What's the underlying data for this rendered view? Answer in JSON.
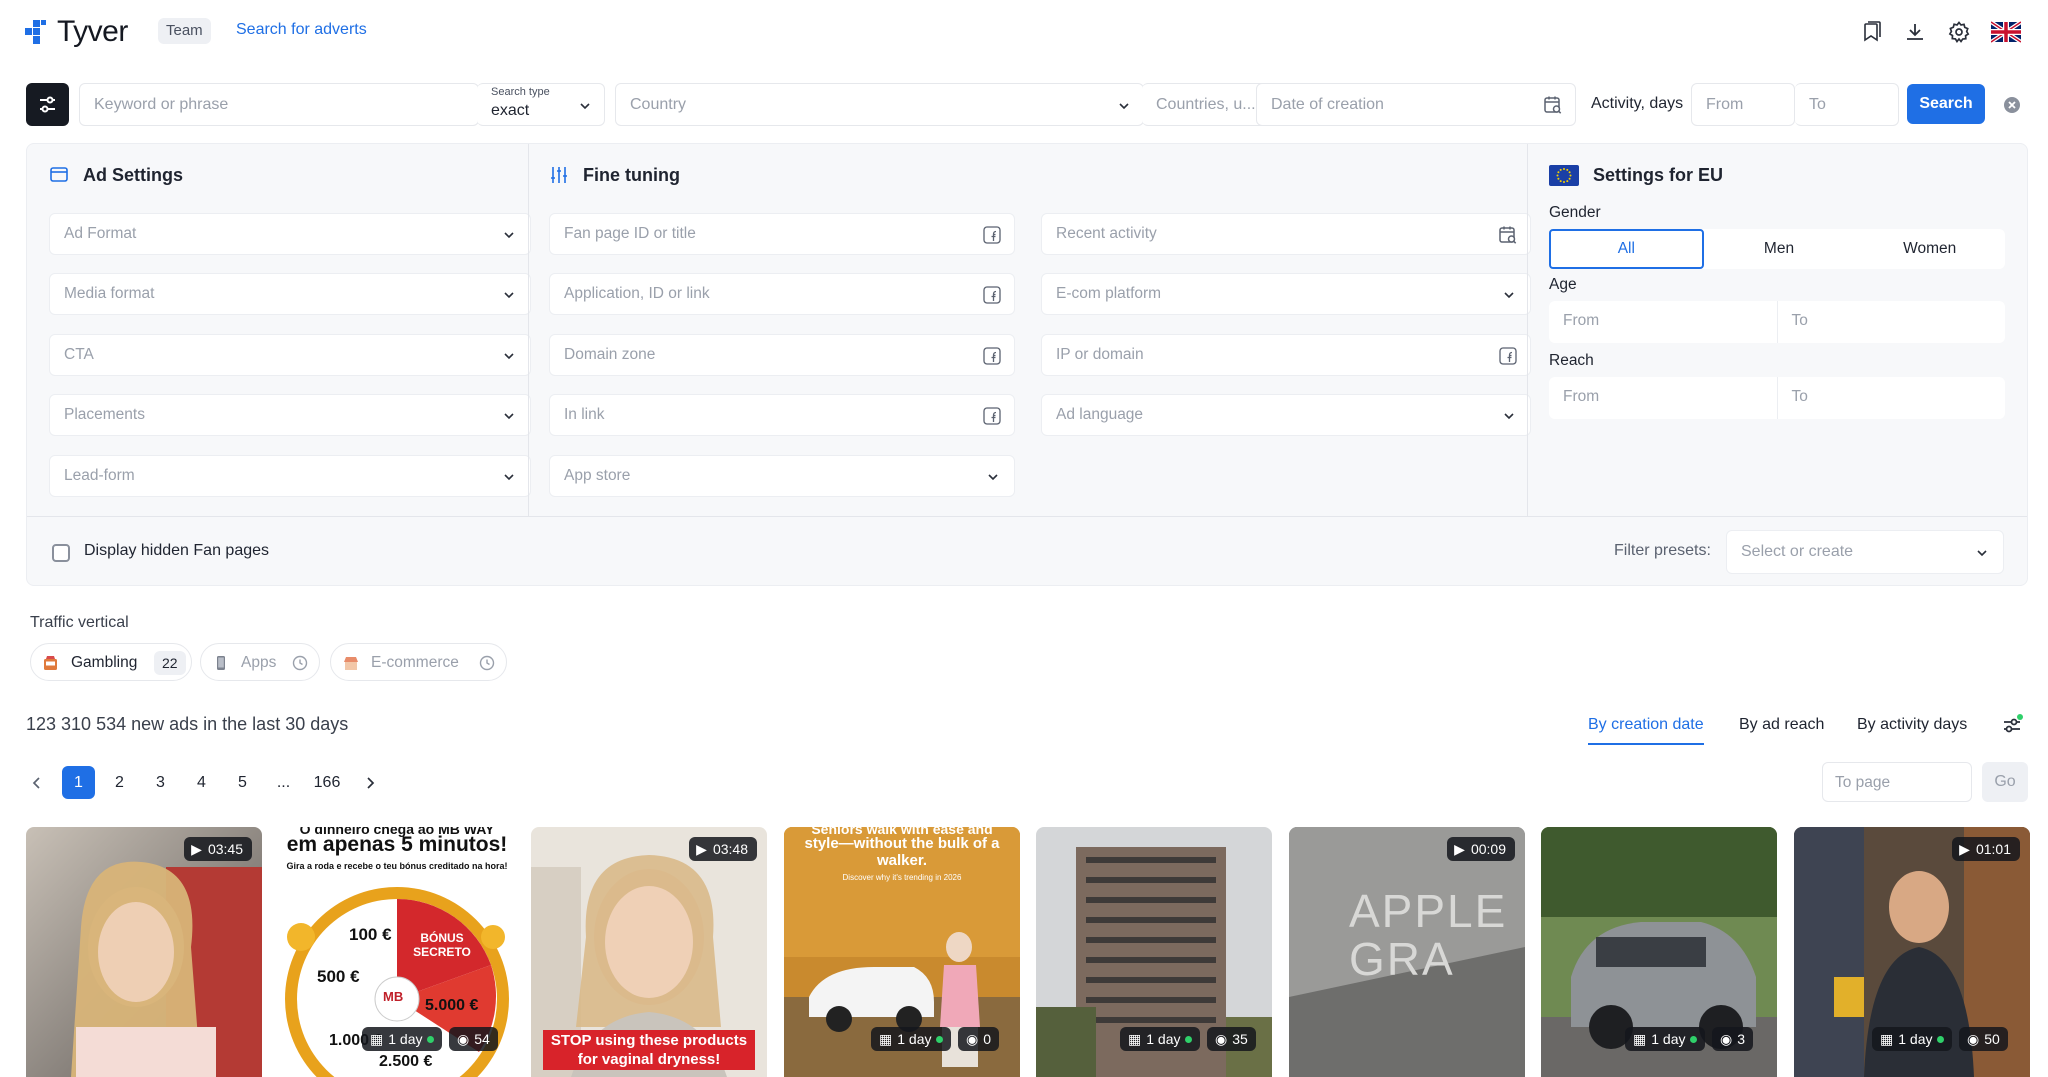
{
  "header": {
    "brand": "Tyver",
    "team_badge": "Team",
    "search_link": "Search for adverts"
  },
  "search": {
    "keyword_placeholder": "Keyword or phrase",
    "search_type_label": "Search type",
    "search_type_value": "exact",
    "country_placeholder": "Country",
    "countries_placeholder": "Countries, u...",
    "date_placeholder": "Date of creation",
    "activity_label": "Activity, days",
    "from_placeholder": "From",
    "to_placeholder": "To",
    "search_button": "Search"
  },
  "ad_settings": {
    "title": "Ad Settings",
    "fields": [
      "Ad Format",
      "Media format",
      "CTA",
      "Placements",
      "Lead-form"
    ]
  },
  "fine_tuning": {
    "title": "Fine tuning",
    "left_fields": [
      "Fan page ID or title",
      "Application, ID or link",
      "Domain zone",
      "In link",
      "App store"
    ],
    "right_fields": [
      "Recent activity",
      "E-com platform",
      "IP or domain",
      "Ad language"
    ]
  },
  "eu_settings": {
    "title": "Settings for EU",
    "gender_label": "Gender",
    "gender_options": [
      "All",
      "Men",
      "Women"
    ],
    "gender_selected": "All",
    "age_label": "Age",
    "reach_label": "Reach",
    "from": "From",
    "to": "To"
  },
  "panel_footer": {
    "hidden_fan_pages": "Display hidden Fan pages",
    "filter_presets_label": "Filter presets:",
    "filter_presets_placeholder": "Select or create"
  },
  "traffic_vertical": {
    "label": "Traffic vertical",
    "chips": [
      {
        "label": "Gambling",
        "count": "22",
        "icon": "slot-machine-icon"
      },
      {
        "label": "Apps",
        "icon": "phone-icon"
      },
      {
        "label": "E-commerce",
        "icon": "shop-icon"
      }
    ]
  },
  "results": {
    "stats": "123 310 534 new ads in the last 30 days",
    "sort_options": [
      "By creation date",
      "By ad reach",
      "By activity days"
    ],
    "sort_active": "By creation date"
  },
  "pagination": {
    "pages": [
      "1",
      "2",
      "3",
      "4",
      "5",
      "...",
      "166"
    ],
    "current": "1",
    "to_page_placeholder": "To page",
    "go_button": "Go"
  },
  "cards": [
    {
      "duration": "03:45",
      "days": "",
      "views": ""
    },
    {
      "duration": "",
      "days": "1 day",
      "views": "54",
      "headline": "em apenas 5 minutos!",
      "subline": "Gira a roda e recebe o teu bónus creditado na hora!",
      "wheel_values": [
        "100 €",
        "BÓNUS SECRETO",
        "500 €",
        "5.000 €",
        "1.000 €",
        "2.500 €"
      ],
      "wheel_center": "MB",
      "top_text": "O dinheiro chega ao MB WAY"
    },
    {
      "duration": "03:48",
      "days": "",
      "views": "",
      "caption": "STOP using these products for vaginal dryness!"
    },
    {
      "duration": "",
      "days": "1 day",
      "views": "0",
      "headline": "style—without the bulk of a walker.",
      "subline": "Discover why it's trending in 2026",
      "top_text": "Seniors walk with ease and"
    },
    {
      "duration": "",
      "days": "1 day",
      "views": "35"
    },
    {
      "duration": "00:09",
      "days": "",
      "views": "",
      "sign_text": "APPLE GRA"
    },
    {
      "duration": "",
      "days": "1 day",
      "views": "3"
    },
    {
      "duration": "01:01",
      "days": "1 day",
      "views": "50"
    }
  ],
  "colors": {
    "accent": "#1f6fe5",
    "dark": "#161a22",
    "panel_bg": "#f7f8fa",
    "active_dot": "#2fd06a"
  }
}
